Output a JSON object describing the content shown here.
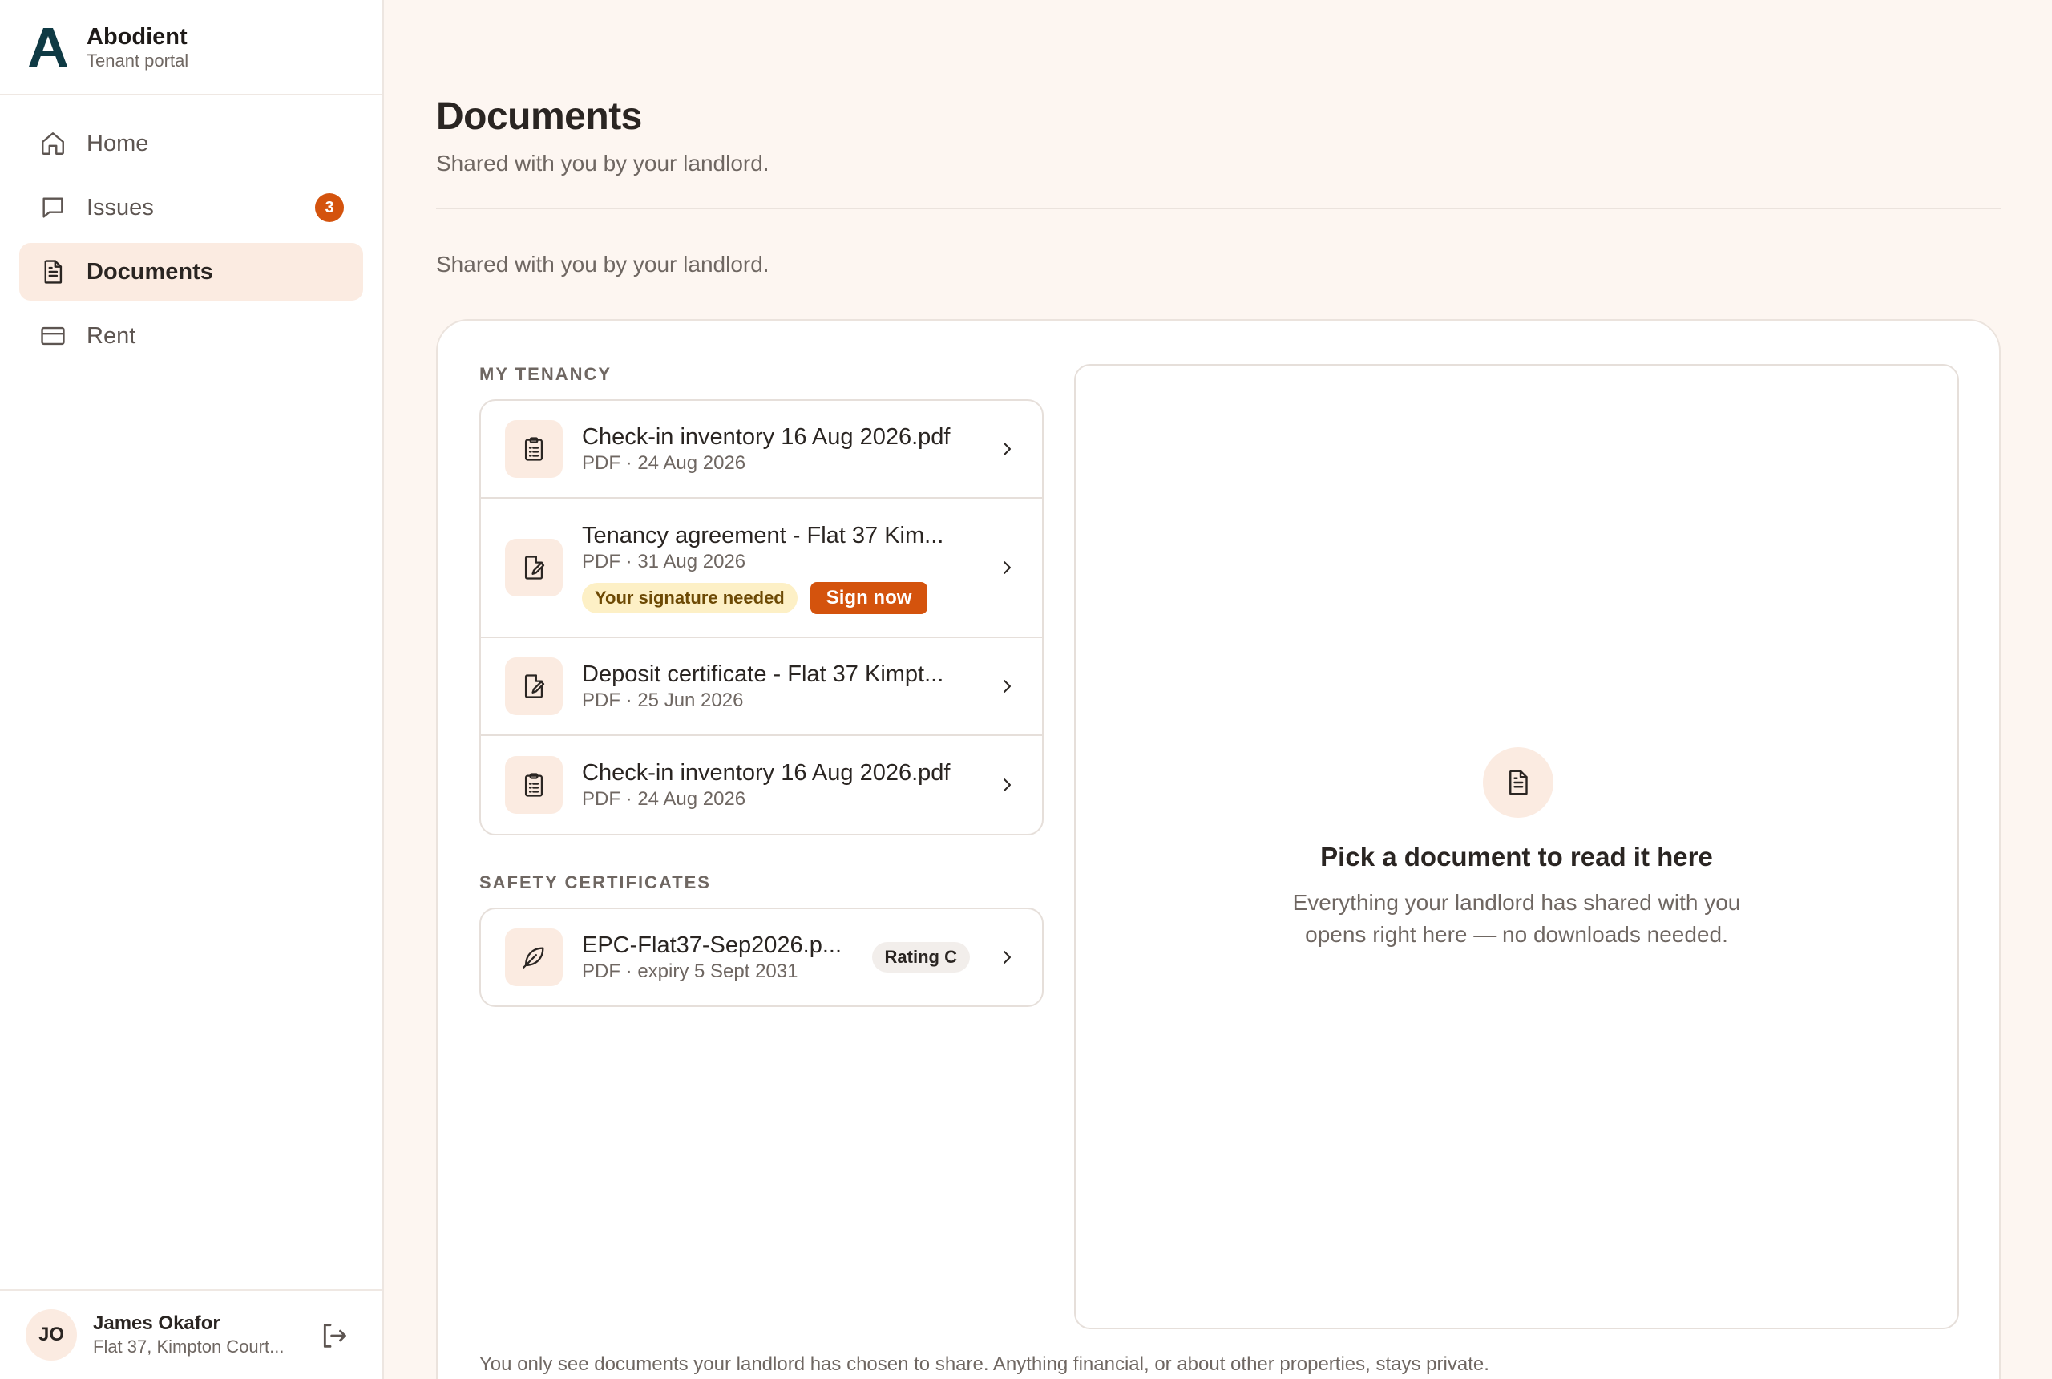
{
  "brand": {
    "name": "Abodient",
    "subtitle": "Tenant portal"
  },
  "nav": {
    "items": [
      {
        "label": "Home",
        "icon": "home-icon"
      },
      {
        "label": "Issues",
        "icon": "message-icon",
        "badge": "3"
      },
      {
        "label": "Documents",
        "icon": "document-icon",
        "active": true
      },
      {
        "label": "Rent",
        "icon": "credit-card-icon"
      }
    ]
  },
  "user": {
    "initials": "JO",
    "name": "James Okafor",
    "address": "Flat 37, Kimpton Court..."
  },
  "page": {
    "title": "Documents",
    "subtitle": "Shared with you by your landlord.",
    "subtitle2": "Shared with you by your landlord."
  },
  "sections": {
    "tenancy": {
      "label": "MY TENANCY",
      "docs": [
        {
          "title": "Check-in inventory 16 Aug 2026.pdf",
          "meta": "PDF · 24 Aug 2026",
          "icon": "clipboard-icon"
        },
        {
          "title": "Tenancy agreement - Flat 37 Kim...",
          "meta": "PDF · 31 Aug 2026",
          "icon": "signature-doc-icon",
          "status": "Your signature needed",
          "action": "Sign now"
        },
        {
          "title": "Deposit certificate - Flat 37 Kimpt...",
          "meta": "PDF · 25 Jun 2026",
          "icon": "signature-doc-icon"
        },
        {
          "title": "Check-in inventory 16 Aug 2026.pdf",
          "meta": "PDF · 24 Aug 2026",
          "icon": "clipboard-icon"
        }
      ]
    },
    "safety": {
      "label": "SAFETY CERTIFICATES",
      "docs": [
        {
          "title": "EPC-Flat37-Sep2026.p...",
          "meta": "PDF · expiry 5 Sept 2031",
          "icon": "leaf-icon",
          "rating": "Rating C"
        }
      ]
    }
  },
  "viewer": {
    "title": "Pick a document to read it here",
    "line1": "Everything your landlord has shared with you",
    "line2": "opens right here — no downloads needed."
  },
  "footnote": "You only see documents your landlord has chosen to share. Anything financial, or about other properties, stays private.",
  "colors": {
    "accent": "#d4530d",
    "accent_soft": "#fbebe1",
    "background": "#fdf6f1",
    "brand_dark": "#0f3a44"
  }
}
